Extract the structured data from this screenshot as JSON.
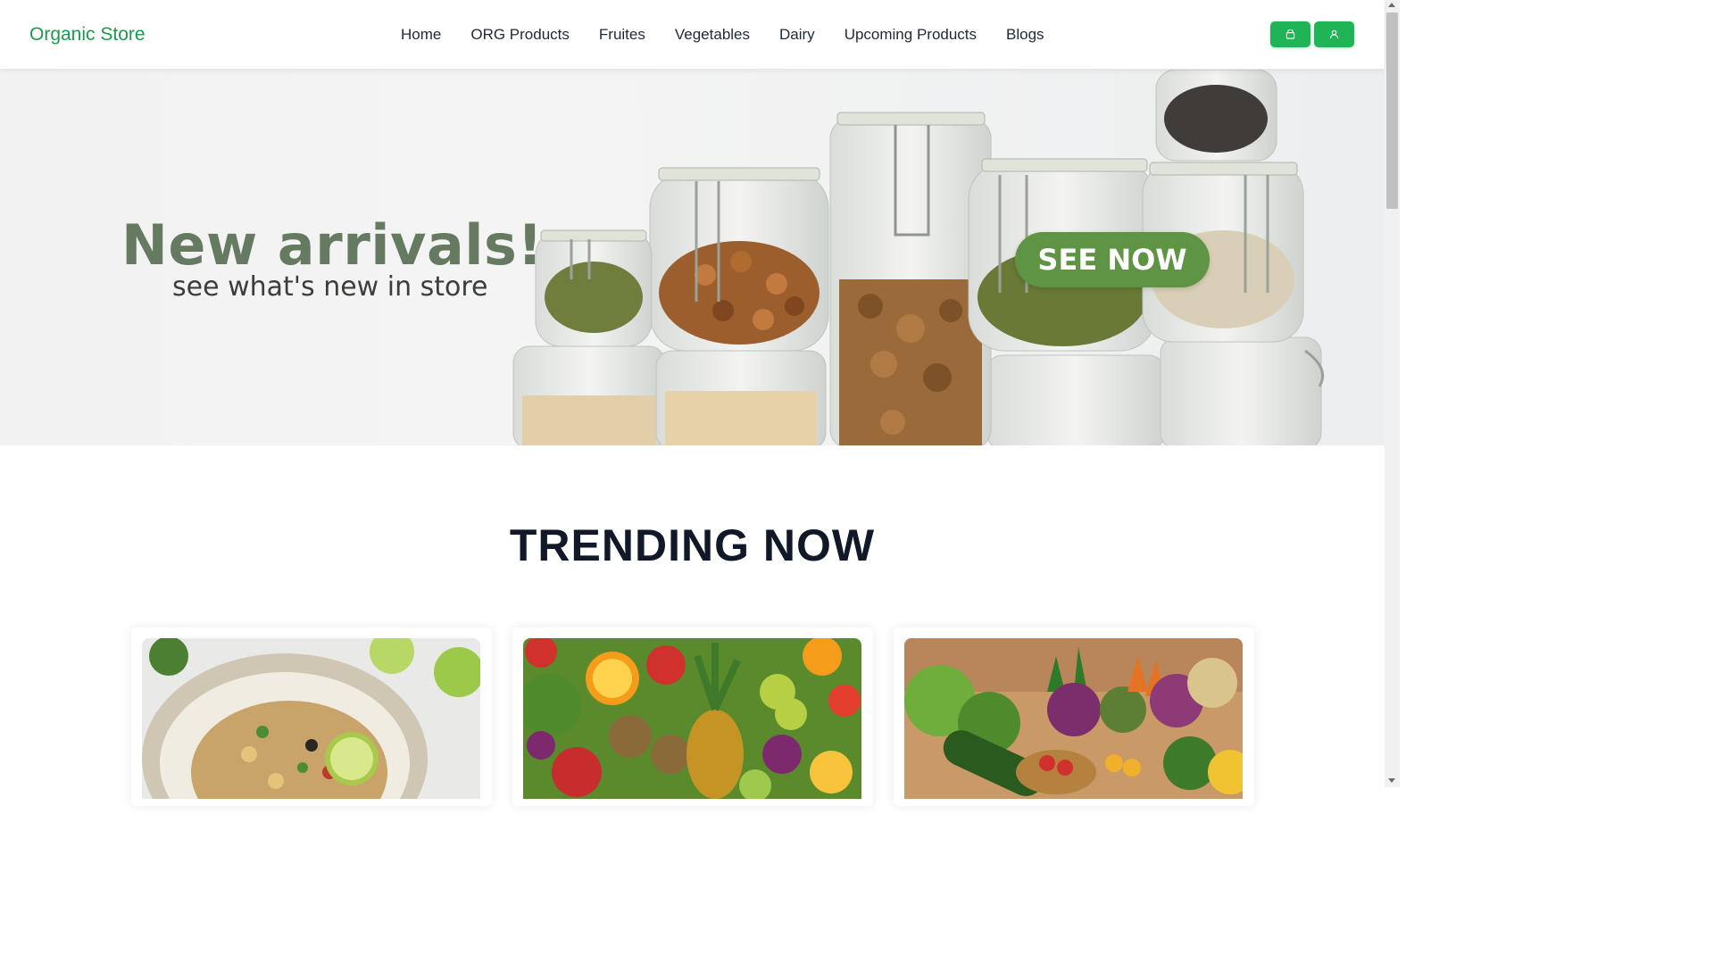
{
  "brand": {
    "name": "Organic Store",
    "color": "#1e9b4a"
  },
  "nav": {
    "links": [
      "Home",
      "ORG Products",
      "Fruites",
      "Vegetables",
      "Dairy",
      "Upcoming Products",
      "Blogs"
    ],
    "actions": [
      {
        "icon": "shopping-bag-icon"
      },
      {
        "icon": "user-icon"
      }
    ],
    "action_color": "#1fb556"
  },
  "hero": {
    "title": "New arrivals!",
    "subtitle": "see what's new in store",
    "cta_label": "SEE NOW",
    "cta_color": "#5e9443",
    "image": "glass-jars-with-nuts-and-seeds"
  },
  "trending": {
    "title": "TRENDING NOW",
    "cards": [
      {
        "image": "quinoa-salad-bowl"
      },
      {
        "image": "assorted-fruits"
      },
      {
        "image": "assorted-vegetables"
      }
    ]
  }
}
